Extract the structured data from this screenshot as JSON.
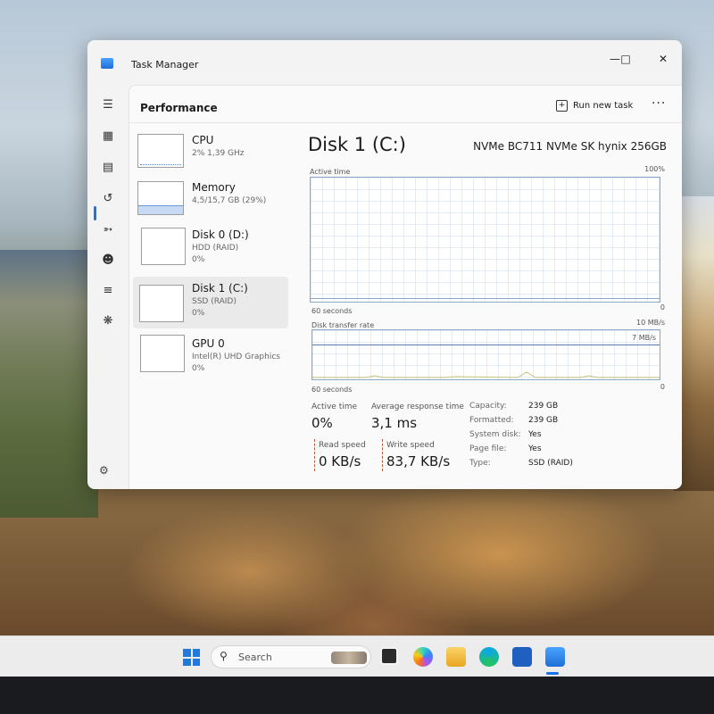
{
  "window": {
    "title": "Task Manager",
    "minimize_icon": "minimize-icon",
    "maximize_icon": "maximize-icon",
    "close_icon": "close-icon"
  },
  "nav": {
    "icons": [
      "hamburger-menu-icon",
      "processes-icon",
      "performance-icon",
      "app-history-icon",
      "startup-apps-icon",
      "users-icon",
      "details-icon",
      "services-icon",
      "settings-icon"
    ],
    "active": "performance"
  },
  "header": {
    "title": "Performance",
    "run_new_task": "Run new task",
    "more": "..."
  },
  "perf_list": [
    {
      "name": "CPU",
      "sub": "2% 1,39 GHz",
      "sub2": ""
    },
    {
      "name": "Memory",
      "sub": "4,5/15,7 GB (29%)",
      "sub2": ""
    },
    {
      "name": "Disk 0 (D:)",
      "sub": "HDD (RAID)",
      "sub2": "0%"
    },
    {
      "name": "Disk 1 (C:)",
      "sub": "SSD (RAID)",
      "sub2": "0%"
    },
    {
      "name": "GPU 0",
      "sub": "Intel(R) UHD Graphics",
      "sub2": "0%"
    }
  ],
  "memory_fill_fraction": 0.29,
  "detail": {
    "title": "Disk 1 (C:)",
    "model": "NVMe BC711 NVMe SK hynix 256GB",
    "active_time_label": "Active time",
    "active_time_max": "100%",
    "graph1_left": "60 seconds",
    "graph1_right": "0",
    "transfer_label": "Disk transfer rate",
    "transfer_max": "10 MB/s",
    "transfer_ref": "7 MB/s",
    "graph2_left": "60 seconds",
    "graph2_right": "0"
  },
  "stats": {
    "active_time_label": "Active time",
    "active_time_value": "0%",
    "avg_response_label": "Average response time",
    "avg_response_value": "3,1 ms",
    "read_label": "Read speed",
    "read_value": "0 KB/s",
    "write_label": "Write speed",
    "write_value": "83,7 KB/s"
  },
  "properties": [
    {
      "key": "Capacity:",
      "value": "239 GB"
    },
    {
      "key": "Formatted:",
      "value": "239 GB"
    },
    {
      "key": "System disk:",
      "value": "Yes"
    },
    {
      "key": "Page file:",
      "value": "Yes"
    },
    {
      "key": "Type:",
      "value": "SSD (RAID)"
    }
  ],
  "taskbar": {
    "search_placeholder": "Search",
    "apps": [
      "start-icon",
      "task-view-icon",
      "copilot-icon",
      "file-explorer-icon",
      "edge-icon",
      "microsoft-store-icon",
      "task-manager-icon"
    ]
  },
  "colors": {
    "accent": "#1a73e8",
    "graph_border": "#8aa9c9"
  }
}
